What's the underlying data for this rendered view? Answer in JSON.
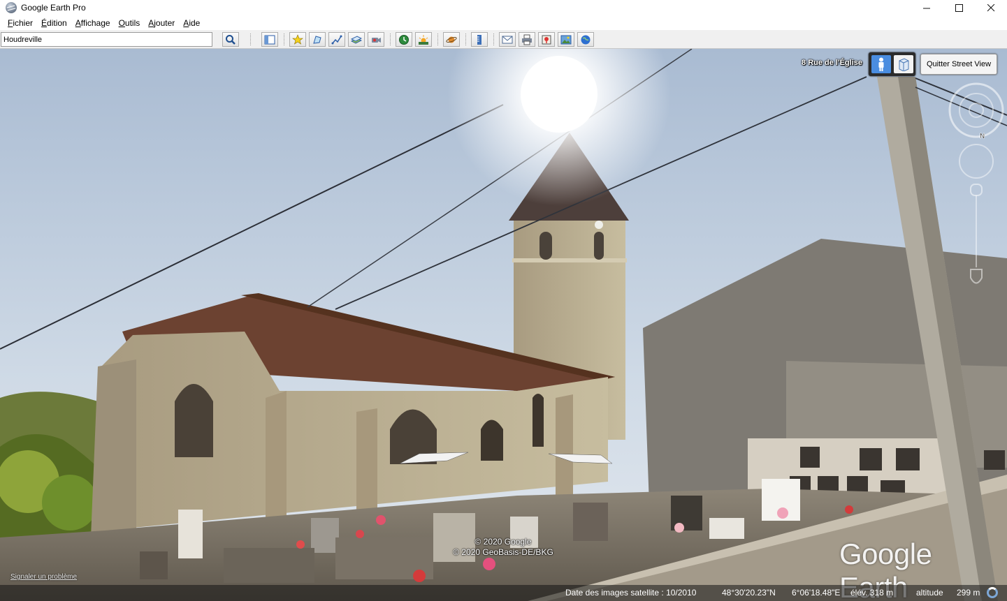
{
  "window": {
    "title": "Google Earth Pro",
    "controls": [
      "—",
      "☐",
      "✕"
    ]
  },
  "menu": [
    {
      "label": "Fichier"
    },
    {
      "label": "Édition"
    },
    {
      "label": "Affichage"
    },
    {
      "label": "Outils"
    },
    {
      "label": "Ajouter"
    },
    {
      "label": "Aide"
    }
  ],
  "toolbar": {
    "search_value": "Houdreville",
    "buttons": [
      "search-icon",
      "sidebar-icon",
      "placemark-icon",
      "polygon-icon",
      "path-icon",
      "image-overlay-icon",
      "record-tour-icon",
      "historical-imagery-icon",
      "sunlight-icon",
      "planets-icon",
      "ruler-icon",
      "email-icon",
      "print-icon",
      "save-image-icon",
      "view-in-maps-icon",
      "earth-gallery-icon"
    ]
  },
  "streetview": {
    "address": "8 Rue de l'Église",
    "quit_label": "Quitter Street View",
    "compass_north": "N",
    "report_link": "Signaler un problème",
    "copyright_lines": [
      "© 2020 Google",
      "© 2020 GeoBasis-DE/BKG"
    ],
    "watermark": "Google Earth"
  },
  "status": {
    "imagery_date": "Date des images satellite : 10/2010",
    "latitude": "48°30'20.23\"N",
    "longitude": "6°06'18.48\"E",
    "elevation": "élév.  318 m",
    "altitude_label": "altitude",
    "altitude_value": "299 m"
  },
  "colors": {
    "sky_top": "#aebfd4",
    "sky_bottom": "#d8e1ea",
    "wall": "#b9ad91",
    "roof": "#6e4535",
    "toggle_active": "#4a8de0"
  }
}
